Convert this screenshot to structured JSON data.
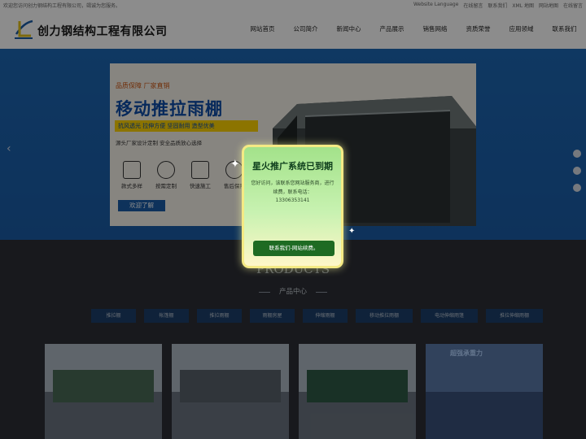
{
  "topbar": {
    "welcome": "欢迎您访问创力钢结构工程有限公司，竭诚为您服务。",
    "links": [
      "Website Language",
      "在线留言",
      "联系我们",
      "XML 地图",
      "网站地图",
      "在线留言"
    ]
  },
  "header": {
    "company_name": "创力钢结构工程有限公司",
    "nav": [
      "网站首页",
      "公司简介",
      "新闻中心",
      "产品展示",
      "销售网络",
      "资质荣誉",
      "应用领域",
      "联系我们"
    ]
  },
  "banner": {
    "tagline": "品质保障 厂家直销",
    "title": "移动推拉雨棚",
    "strip": "抗风透光 拉伸方便 坚固耐用 造型优美",
    "subtitle": "源头厂家设计定制 安全品质放心选择",
    "features": [
      "款式多样",
      "按需定制",
      "快速施工",
      "售后保障"
    ],
    "more_button": "欢迎了解",
    "prev_arrow": "‹"
  },
  "products": {
    "heading_en": "PRODUCTS",
    "heading_cn": "产品中心",
    "categories": [
      "推拉棚",
      "帐篷棚",
      "推拉雨棚",
      "雨棚房屋",
      "伸缩雨棚",
      "移动推拉雨棚",
      "电动伸缩雨篷",
      "推拉伸缩雨棚"
    ],
    "card_tag": "超强承重力"
  },
  "popup": {
    "title": "星火推广系统已到期",
    "message": "您好访问，该联系您网站服务商，进行续费，联系电话：",
    "phone": "13306353141",
    "button": "联系我们-网站续费。"
  },
  "colors": {
    "banner_blue": "#1d66b2",
    "popup_green": "#a3e28a",
    "popup_button": "#1e6b23",
    "popup_border": "#f4ea84"
  },
  "icons": [
    "logo-mark",
    "sparkle-icon",
    "phone-icon",
    "wechat-icon",
    "message-icon",
    "arrow-left-icon"
  ]
}
